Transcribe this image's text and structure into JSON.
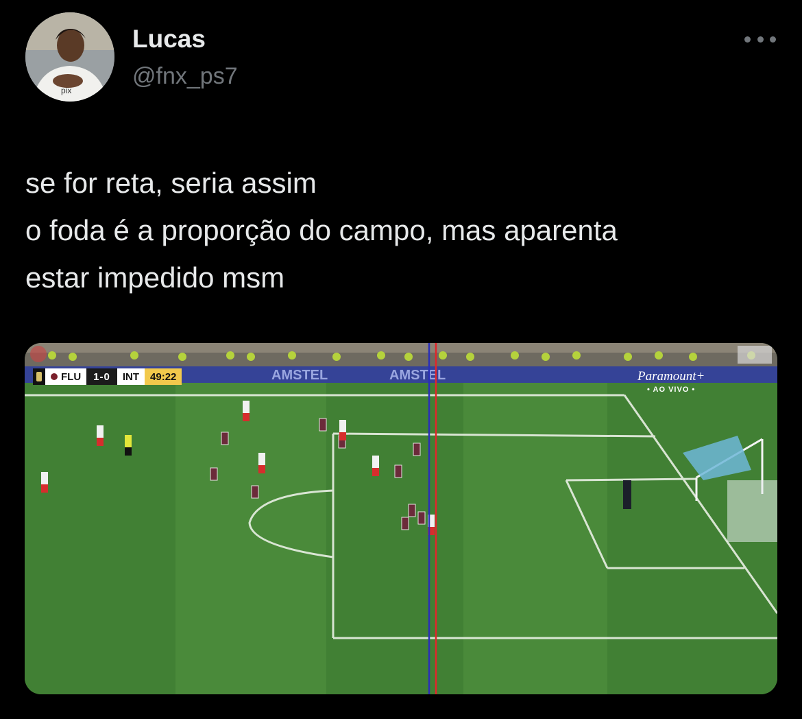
{
  "author": {
    "display_name": "Lucas",
    "handle": "@fnx_ps7",
    "avatar_icon": "profile-photo"
  },
  "tweet": {
    "text": "se for reta, seria assim\no foda é a proporção do campo, mas aparenta\nestar impedido msm"
  },
  "media": {
    "scoreboard": {
      "home": "FLU",
      "score": "1-0",
      "away": "INT",
      "clock": "49:22",
      "home_color": "#7a1f2b",
      "away_color": "#c8102e"
    },
    "broadcaster": {
      "name": "Paramount+",
      "status": "• AO VIVO •"
    },
    "ad_boards": [
      "AMSTEL",
      "AMSTEL"
    ],
    "offside_line_colors": [
      "#2a2fb8",
      "#e0262b"
    ]
  },
  "colors": {
    "background": "#000000",
    "text_primary": "#e7e9ea",
    "text_secondary": "#71767b",
    "pitch_light": "#4a8a3a",
    "pitch_dark": "#3c7630"
  }
}
